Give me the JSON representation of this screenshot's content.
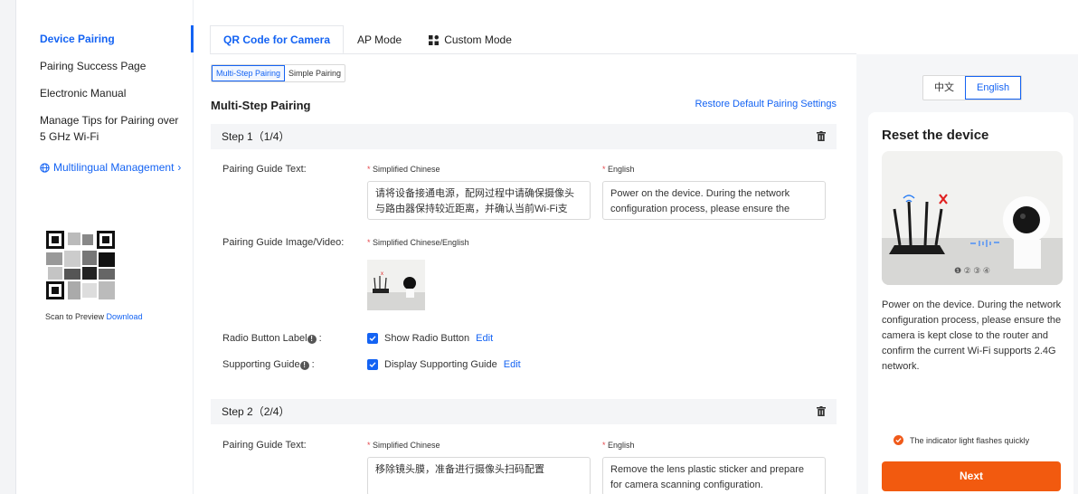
{
  "sidebar": {
    "items": [
      {
        "label": "Device Pairing"
      },
      {
        "label": "Pairing Success Page"
      },
      {
        "label": "Electronic Manual"
      },
      {
        "label": "Manage Tips for Pairing over 5 GHz Wi-Fi"
      }
    ],
    "multilingual_label": "Multilingual Management",
    "scan_text": "Scan to Preview",
    "download_label": "Download"
  },
  "tabs": [
    {
      "label": "QR Code for Camera"
    },
    {
      "label": "AP Mode"
    },
    {
      "label": "Custom Mode"
    }
  ],
  "pairing_type": {
    "options": [
      "Multi-Step Pairing",
      "Simple Pairing"
    ],
    "selected": "Multi-Step Pairing"
  },
  "section": {
    "title": "Multi-Step Pairing",
    "restore_label": "Restore Default Pairing Settings"
  },
  "steps": [
    {
      "title": "Step 1（1/4）",
      "guide_text_label": "Pairing Guide Text:",
      "zh_label": "Simplified Chinese",
      "en_label": "English",
      "zh_text": "请将设备接通电源，配网过程中请确保摄像头与路由器保持较近距离，并确认当前Wi-Fi支",
      "en_text": "Power on the device. During the network configuration process, please ensure the",
      "media_label": "Pairing Guide Image/Video:",
      "media_lang_label": "Simplified Chinese/English",
      "radio_label": "Radio Button Label",
      "radio_value": "Show Radio Button",
      "support_label": "Supporting Guide",
      "support_value": "Display Supporting Guide",
      "edit_label": "Edit"
    },
    {
      "title": "Step 2（2/4）",
      "guide_text_label": "Pairing Guide Text:",
      "zh_label": "Simplified Chinese",
      "en_label": "English",
      "zh_text": "移除镜头膜，准备进行摄像头扫码配置",
      "en_text": "Remove the lens plastic sticker and prepare for camera scanning configuration."
    }
  ],
  "preview": {
    "languages": [
      "中文",
      "English"
    ],
    "selected_language": "English",
    "title": "Reset the device",
    "pager": "❶ ② ③ ④",
    "description": "Power on the device. During the network configuration process, please ensure the camera is kept close to the router and confirm the current Wi-Fi supports 2.4G network.",
    "hint": "The indicator light flashes quickly",
    "next_label": "Next"
  },
  "colors": {
    "accent": "#1463f3",
    "next": "#f25a0f",
    "required": "#e5484d"
  }
}
